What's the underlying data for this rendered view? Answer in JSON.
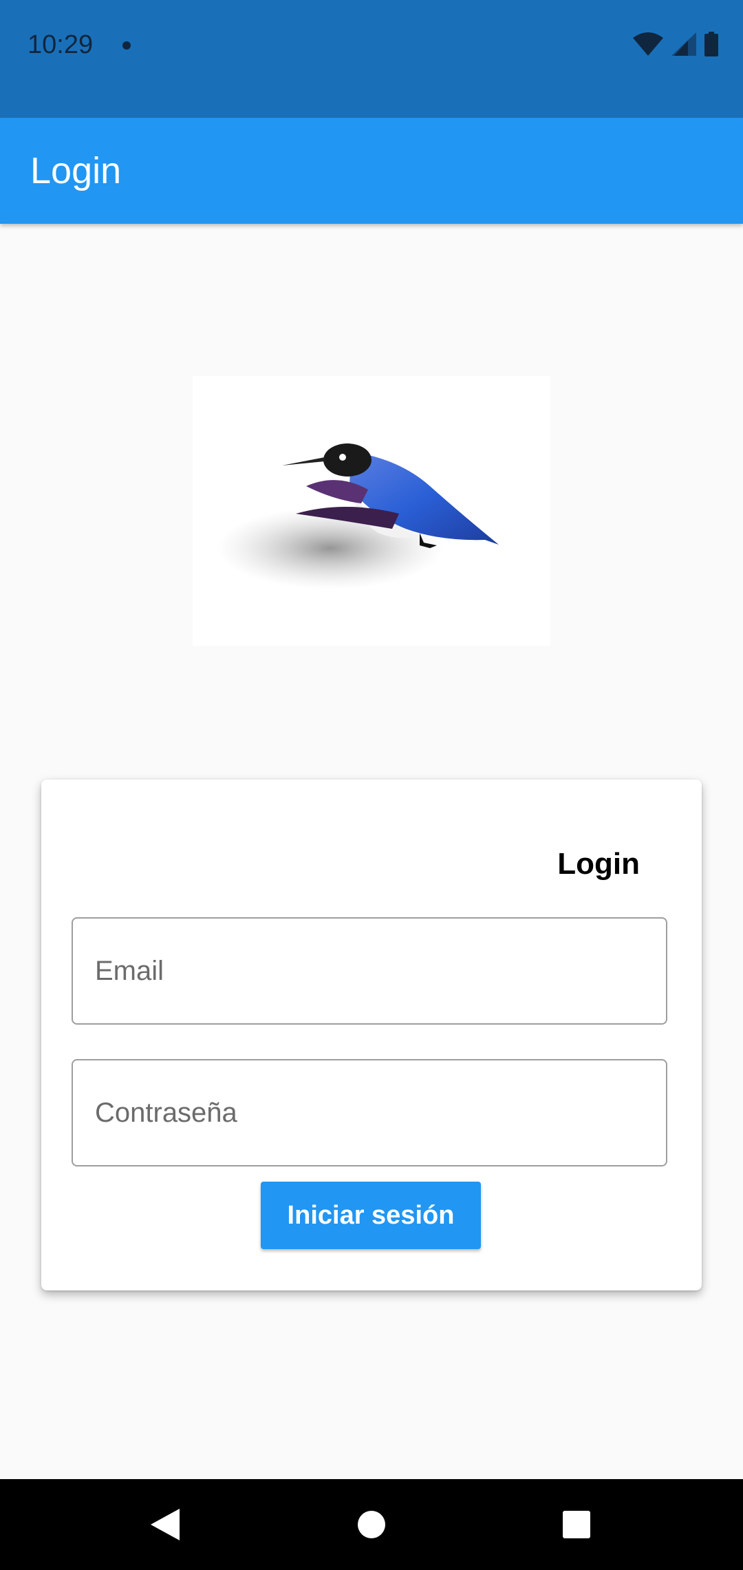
{
  "status_bar": {
    "time": "10:29",
    "icons": [
      "notification-dot-icon",
      "wifi-icon",
      "signal-icon",
      "battery-icon"
    ]
  },
  "app_bar": {
    "title": "Login"
  },
  "logo": {
    "icon": "hummingbird-logo",
    "colors": {
      "body": "#2a5fd6",
      "wing": "#3b1f4d"
    }
  },
  "login_card": {
    "title": "Login",
    "email": {
      "value": "",
      "placeholder": "Email"
    },
    "password": {
      "value": "",
      "placeholder": "Contraseña"
    },
    "submit_label": "Iniciar sesión"
  },
  "nav_bar": {
    "buttons": [
      "back-icon",
      "home-icon",
      "recents-icon"
    ]
  },
  "colors": {
    "primary": "#2196f3",
    "status_bar": "#1a70b8",
    "background": "#fafafa"
  }
}
